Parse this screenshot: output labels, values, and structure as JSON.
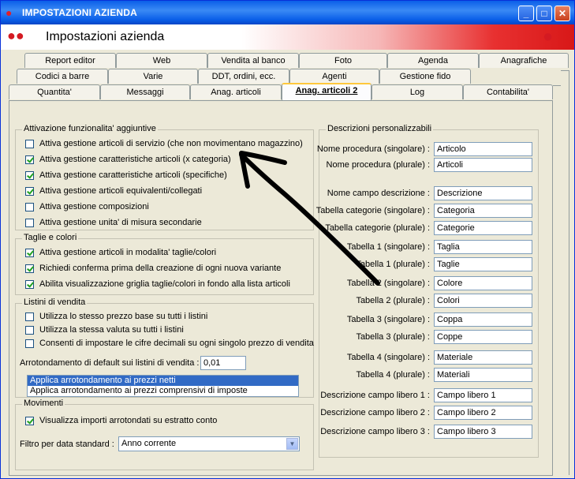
{
  "window": {
    "title": "IMPOSTAZIONI AZIENDA",
    "buttons": {
      "minimize": "_",
      "maximize": "□",
      "close": "✕"
    },
    "icon": "strawberry-icon"
  },
  "header": {
    "title": "Impostazioni azienda",
    "logo_left": "strawberries-icon",
    "logo_right": "strawberry-icon"
  },
  "tabs": {
    "row1": [
      "Report editor",
      "Web",
      "Vendita al banco",
      "Foto",
      "Agenda",
      "Anagrafiche"
    ],
    "row2": [
      "Codici a barre",
      "Varie",
      "DDT, ordini, ecc.",
      "Agenti",
      "Gestione fido"
    ],
    "row3": [
      "Quantita'",
      "Messaggi",
      "Anag. articoli",
      "Anag. articoli 2",
      "Log",
      "Contabilita'"
    ],
    "active": "Anag. articoli 2"
  },
  "attivazione": {
    "title": "Attivazione funzionalita' aggiuntive",
    "items": [
      {
        "label": "Attiva gestione articoli di servizio (che non movimentano magazzino)",
        "checked": false
      },
      {
        "label": "Attiva gestione caratteristiche articoli (x categoria)",
        "checked": true
      },
      {
        "label": "Attiva gestione caratteristiche articoli (specifiche)",
        "checked": true
      },
      {
        "label": "Attiva gestione articoli equivalenti/collegati",
        "checked": true
      },
      {
        "label": "Attiva gestione composizioni",
        "checked": false
      },
      {
        "label": "Attiva gestione unita' di misura secondarie",
        "checked": false
      }
    ]
  },
  "taglie": {
    "title": "Taglie e colori",
    "items": [
      {
        "label": "Attiva gestione articoli in modalita' taglie/colori",
        "checked": true
      },
      {
        "label": "Richiedi conferma prima della creazione di ogni nuova variante",
        "checked": true
      },
      {
        "label": "Abilita visualizzazione griglia taglie/colori in fondo alla lista articoli",
        "checked": true
      }
    ]
  },
  "listini": {
    "title": "Listini di vendita",
    "items": [
      {
        "label": "Utilizza lo stesso prezzo base su tutti i listini",
        "checked": false
      },
      {
        "label": "Utilizza la stessa valuta su tutti i listini",
        "checked": false
      },
      {
        "label": "Consenti di impostare le cifre decimali su ogni singolo prezzo di vendita",
        "checked": false
      }
    ],
    "rounding_label": "Arrotondamento di default sui listini di vendita :",
    "rounding_value": "0,01",
    "rounding_options": [
      "Applica arrotondamento ai prezzi netti",
      "Applica arrotondamento ai prezzi comprensivi di imposte"
    ]
  },
  "movimenti": {
    "title": "Movimenti",
    "items": [
      {
        "label": "Visualizza importi arrotondati su estratto conto",
        "checked": true
      }
    ],
    "filter_label": "Filtro per data standard :",
    "filter_value": "Anno corrente"
  },
  "descrizioni": {
    "title": "Descrizioni personalizzabili",
    "fields": [
      {
        "label": "Nome procedura (singolare) :",
        "value": "Articolo"
      },
      {
        "label": "Nome procedura (plurale) :",
        "value": "Articoli"
      },
      {
        "label": "Nome campo descrizione :",
        "value": "Descrizione"
      },
      {
        "label": "Tabella categorie (singolare) :",
        "value": "Categoria"
      },
      {
        "label": "Tabella categorie (plurale) :",
        "value": "Categorie"
      },
      {
        "label": "Tabella 1 (singolare) :",
        "value": "Taglia"
      },
      {
        "label": "Tabella 1 (plurale) :",
        "value": "Taglie"
      },
      {
        "label": "Tabella 2 (singolare) :",
        "value": "Colore"
      },
      {
        "label": "Tabella 2 (plurale) :",
        "value": "Colori"
      },
      {
        "label": "Tabella 3 (singolare) :",
        "value": "Coppa"
      },
      {
        "label": "Tabella 3 (plurale) :",
        "value": "Coppe"
      },
      {
        "label": "Tabella 4 (singolare) :",
        "value": "Materiale"
      },
      {
        "label": "Tabella 4 (plurale) :",
        "value": "Materiali"
      },
      {
        "label": "Descrizione campo libero 1 :",
        "value": "Campo libero 1"
      },
      {
        "label": "Descrizione campo libero 2 :",
        "value": "Campo libero 2"
      },
      {
        "label": "Descrizione campo libero 3 :",
        "value": "Campo libero 3"
      }
    ]
  },
  "colors": {
    "titlebar": "#0a5ee8",
    "selection": "#316ac5",
    "active_tab_accent": "#ffc83c",
    "check": "#21a121"
  }
}
